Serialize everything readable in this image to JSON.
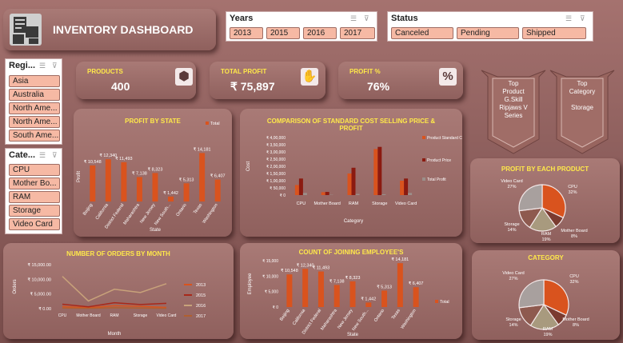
{
  "title": "INVENTORY DASHBOARD",
  "years_slicer": {
    "header": "Years",
    "items": [
      "2013",
      "2015",
      "2016",
      "2017"
    ]
  },
  "status_slicer": {
    "header": "Status",
    "items": [
      "Canceled",
      "Pending",
      "Shipped"
    ]
  },
  "region_slicer": {
    "header": "Regi...",
    "items": [
      "Asia",
      "Australia",
      "North Ame...",
      "North Ame...",
      "South Ame..."
    ]
  },
  "category_slicer": {
    "header": "Cate...",
    "items": [
      "CPU",
      "Mother Bo...",
      "RAM",
      "Storage",
      "Video Card"
    ]
  },
  "kpis": {
    "products": {
      "label": "PRODUCTS",
      "value": "400",
      "icon": "box-icon"
    },
    "total_profit": {
      "label": "TOTAL PROFIT",
      "value": "₹ 75,897",
      "icon": "hand-coin-icon"
    },
    "profit_pct": {
      "label": "PROFIT %",
      "value": "76%",
      "icon": "percent-icon"
    }
  },
  "banners": {
    "top_product": {
      "line1": "Top",
      "line2": "Product",
      "line3": "G.Skill",
      "line4": "Ripjaws V",
      "line5": "Series"
    },
    "top_category": {
      "line1": "Top",
      "line2": "Category",
      "line3": "",
      "line4": "Storage",
      "line5": ""
    }
  },
  "charts": {
    "profit_by_state": {
      "title": "PROFIT BY STATE"
    },
    "comparison": {
      "title_line1": "COMPARISON OF STANDARD COST SELLING PRICE &",
      "title_line2": "PROFIT"
    },
    "profit_by_product": {
      "title": "PROFIT BY EACH PRODUCT"
    },
    "orders_by_month": {
      "title": "NUMBER OF ORDERS BY MONTH"
    },
    "joining_employees": {
      "title": "COUNT OF JOINING EMPLOYEE'S"
    },
    "category": {
      "title": "CATEGORY"
    }
  },
  "chart_data": [
    {
      "type": "bar",
      "title": "PROFIT BY STATE",
      "xlabel": "State",
      "ylabel": "Profit",
      "categories": [
        "Beijing",
        "California",
        "District Federal",
        "Maharashtra",
        "New Jersey",
        "New South...",
        "Ontario",
        "Texas",
        "Washington"
      ],
      "series": [
        {
          "name": "Total",
          "values": [
            10548,
            12340,
            11493,
            7138,
            8323,
            1442,
            5313,
            14181,
            6407
          ]
        }
      ],
      "data_labels": [
        "₹ 10,548",
        "₹ 12,340",
        "₹ 11,493",
        "₹ 7,138",
        "₹ 8,323",
        "₹ 1,442",
        "₹ 5,313",
        "₹ 14,181",
        "₹ 6,407"
      ],
      "legend": "top-right"
    },
    {
      "type": "bar",
      "title": "COMPARISON OF STANDARD COST SELLING PRICE & PROFIT",
      "xlabel": "Category",
      "ylabel": "Cost",
      "yticks": [
        "₹ 0",
        "₹ 50,000",
        "₹ 1,00,000",
        "₹ 1,50,000",
        "₹ 2,00,000",
        "₹ 2,50,000",
        "₹ 3,00,000",
        "₹ 3,50,000",
        "₹ 4,00,000"
      ],
      "ylim": [
        0,
        400000
      ],
      "categories": [
        "CPU",
        "Mother Board",
        "RAM",
        "Storage",
        "Video Card"
      ],
      "series": [
        {
          "name": "Product Standard Cost",
          "values": [
            70000,
            20000,
            150000,
            320000,
            100000
          ]
        },
        {
          "name": "Product Price",
          "values": [
            115000,
            22000,
            190000,
            335000,
            115000
          ]
        },
        {
          "name": "Total Profit",
          "values": [
            15000,
            2000,
            8000,
            6000,
            15000
          ]
        }
      ],
      "legend": "right"
    },
    {
      "type": "pie",
      "title": "PROFIT BY EACH PRODUCT",
      "labels": [
        "CPU",
        "Mother Board",
        "RAM",
        "Storage",
        "Video Card"
      ],
      "values": [
        32,
        8,
        19,
        14,
        27
      ],
      "data_labels": [
        "CPU 32%",
        "Mother Board 8%",
        "RAM 19%",
        "Storage 14%",
        "Video Card 27%"
      ]
    },
    {
      "type": "line",
      "title": "NUMBER OF ORDERS BY MONTH",
      "xlabel": "Month",
      "ylabel": "Orders",
      "yticks": [
        "₹ 0.00",
        "₹ 5,000.00",
        "₹ 10,000.00",
        "₹ 15,000.00"
      ],
      "ylim": [
        0,
        15000
      ],
      "categories": [
        "CPU",
        "Mother Board",
        "RAM",
        "Storage",
        "Video Card"
      ],
      "series": [
        {
          "name": "2013",
          "values": [
            700,
            300,
            1000,
            800,
            400
          ]
        },
        {
          "name": "2015",
          "values": [
            1500,
            600,
            2000,
            1400,
            1800
          ]
        },
        {
          "name": "2016",
          "values": [
            11000,
            2600,
            6600,
            5500,
            8500
          ]
        },
        {
          "name": "2017",
          "values": [
            200,
            100,
            300,
            200,
            100
          ]
        }
      ],
      "legend": "right"
    },
    {
      "type": "bar",
      "title": "COUNT OF JOINING EMPLOYEE'S",
      "xlabel": "State",
      "ylabel": "Employee",
      "yticks": [
        "₹ 0",
        "₹ 5,000",
        "₹ 10,000",
        "₹ 15,000"
      ],
      "ylim": [
        0,
        15000
      ],
      "categories": [
        "Beijing",
        "California",
        "District Federal",
        "Maharashtra",
        "New Jersey",
        "New South...",
        "Ontario",
        "Texas",
        "Washington"
      ],
      "series": [
        {
          "name": "Total",
          "values": [
            10548,
            12340,
            11493,
            7138,
            8323,
            1442,
            5313,
            14181,
            6407
          ]
        }
      ],
      "data_labels": [
        "₹ 10,548",
        "₹ 12,340",
        "₹ 11,493",
        "₹ 7,138",
        "₹ 8,323",
        "₹ 1,442",
        "₹ 5,313",
        "₹ 14,181",
        "₹ 6,407"
      ],
      "legend": "right"
    },
    {
      "type": "pie",
      "title": "CATEGORY",
      "labels": [
        "CPU",
        "Mother Board",
        "RAM",
        "Storage",
        "Video Card"
      ],
      "values": [
        32,
        8,
        19,
        14,
        27
      ],
      "data_labels": [
        "CPU 32%",
        "Mother Board 8%",
        "RAM 19%",
        "Storage 14%",
        "Video Card 27%"
      ]
    }
  ],
  "colors": {
    "bar": "#d9531e",
    "bar_dark": "#8b1a10",
    "bar_grey": "#9b8f8a",
    "accent_yellow": "#ffe94a",
    "chip": "#f6b9a4",
    "pie": [
      "#d9531e",
      "#7a3b30",
      "#a89a7e",
      "#8e5a4f",
      "#a8a09e"
    ],
    "lines": [
      "#d9531e",
      "#a8281a",
      "#c8a27a",
      "#b06030"
    ]
  }
}
